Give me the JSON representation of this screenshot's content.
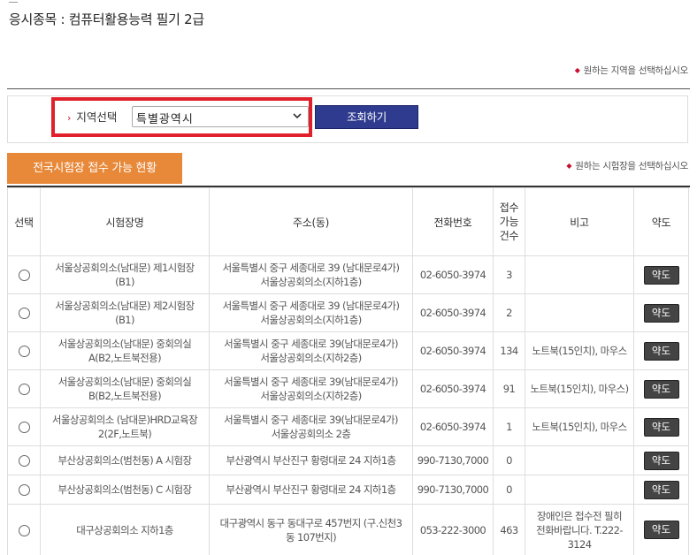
{
  "exam": {
    "title": "응시종목 : 컴퓨터활용능력 필기 2급"
  },
  "hints": {
    "region": "원하는 지역을 선택하십시오",
    "center": "원하는 시험장을 선택하십시오"
  },
  "region_form": {
    "arrow": "›",
    "label": "지역선택",
    "selected": "특별광역시",
    "search_button": "조회하기"
  },
  "status_tab": "전국시험장 접수 가능 현황",
  "table": {
    "headers": [
      "선택",
      "시험장명",
      "주소(동)",
      "전화번호",
      "접수가능건수",
      "비고",
      "약도"
    ],
    "capacity_header_lines": [
      "접수",
      "가능",
      "건수"
    ],
    "map_button": "약도",
    "rows": [
      {
        "name": [
          "서울상공회의소(남대문) 제1시험장",
          "(B1)"
        ],
        "address": [
          "서울특별시 중구 세종대로 39 (남대문로4가)",
          "서울상공회의소(지하1층)"
        ],
        "phone": "02-6050-3974",
        "count": "3",
        "note": []
      },
      {
        "name": [
          "서울상공회의소(남대문) 제2시험장",
          "(B1)"
        ],
        "address": [
          "서울특별시 중구 세종대로 39 (남대문로4가)",
          "서울상공회의소(지하1층)"
        ],
        "phone": "02-6050-3974",
        "count": "2",
        "note": []
      },
      {
        "name": [
          "서울상공회의소(남대문) 중회의실",
          "A(B2,노트북전용)"
        ],
        "address": [
          "서울특별시 중구 세종대로 39(남대문로4가)",
          "서울상공회의소(지하2층)"
        ],
        "phone": "02-6050-3974",
        "count": "134",
        "note": [
          "노트북(15인치), 마우스"
        ]
      },
      {
        "name": [
          "서울상공회의소(남대문) 중회의실",
          "B(B2,노트북전용)"
        ],
        "address": [
          "서울특별시 중구 세종대로 39(남대문로4가)",
          "서울상공회의소(지하2층)"
        ],
        "phone": "02-6050-3974",
        "count": "91",
        "note": [
          "노트북(15인치), 마우스)"
        ]
      },
      {
        "name": [
          "서울상공회의소 (남대문)HRD교육장",
          "2(2F,노트북)"
        ],
        "address": [
          "서울특별시 중구 세종대로 39(남대문로4가)",
          "서울상공회의소 2층"
        ],
        "phone": "02-6050-3974",
        "count": "1",
        "note": [
          "노트북(15인치), 마우스"
        ]
      },
      {
        "name": [
          "부산상공회의소(범천동) A 시험장"
        ],
        "address": [
          "부산광역시 부산진구 황령대로 24 지하1층"
        ],
        "phone": "990-7130,7000",
        "count": "0",
        "note": []
      },
      {
        "name": [
          "부산상공회의소(범천동) C 시험장"
        ],
        "address": [
          "부산광역시 부산진구 황령대로 24 지하1층"
        ],
        "phone": "990-7130,7000",
        "count": "0",
        "note": []
      },
      {
        "name": [
          "대구상공회의소 지하1층"
        ],
        "address": [
          "대구광역시 동구 동대구로 457번지 (구.신천3",
          "동 107번지)"
        ],
        "phone": "053-222-3000",
        "count": "463",
        "note": [
          "장애인은 접수전 필히",
          "전화바랍니다. T.222-",
          "3124"
        ]
      }
    ]
  },
  "colors": {
    "accent_red": "#e0202a",
    "button_navy": "#2e3b8e",
    "tab_orange": "#e8893a",
    "note_red": "#c0282e"
  }
}
